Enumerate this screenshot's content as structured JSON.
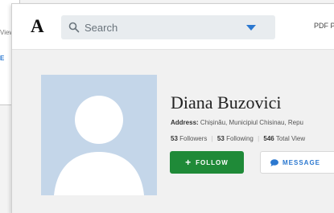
{
  "background_page": {
    "views_fragment": "Views",
    "button_fragment": "E"
  },
  "header": {
    "logo": "A",
    "search_placeholder": "Search",
    "pdf_link": "PDF P"
  },
  "profile": {
    "name": "Diana Buzovici",
    "address_label": "Address:",
    "address_value": "Chișinău, Municipiul Chisinau, Repu",
    "followers_count": "53",
    "followers_label": "Followers",
    "following_count": "53",
    "following_label": "Following",
    "views_count": "546",
    "views_label": "Total View"
  },
  "actions": {
    "follow_label": "FOLLOW",
    "message_label": "MESSAGE"
  },
  "colors": {
    "accent_blue": "#2b78d0",
    "follow_green": "#1f8a38",
    "avatar_bg": "#c4d6e9"
  }
}
